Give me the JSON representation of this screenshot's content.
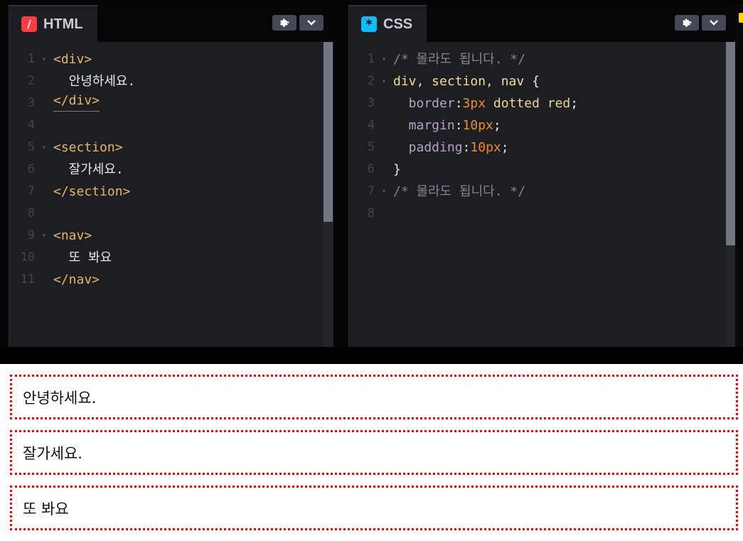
{
  "html_panel": {
    "title": "HTML",
    "icon_glyph": "/",
    "lines": [
      {
        "n": "1",
        "fold": true,
        "parts": [
          {
            "t": "<div>",
            "c": "tag"
          }
        ]
      },
      {
        "n": "2",
        "fold": false,
        "parts": [
          {
            "t": "  안녕하세요.",
            "c": "txt"
          }
        ]
      },
      {
        "n": "3",
        "fold": false,
        "parts": [
          {
            "t": "</div>",
            "c": "tag tag-ul"
          }
        ]
      },
      {
        "n": "4",
        "fold": false,
        "parts": []
      },
      {
        "n": "5",
        "fold": true,
        "parts": [
          {
            "t": "<section>",
            "c": "tag"
          }
        ]
      },
      {
        "n": "6",
        "fold": false,
        "parts": [
          {
            "t": "  잘가세요.",
            "c": "txt"
          }
        ]
      },
      {
        "n": "7",
        "fold": false,
        "parts": [
          {
            "t": "</section>",
            "c": "tag"
          }
        ]
      },
      {
        "n": "8",
        "fold": false,
        "parts": []
      },
      {
        "n": "9",
        "fold": true,
        "parts": [
          {
            "t": "<nav>",
            "c": "tag"
          }
        ]
      },
      {
        "n": "10",
        "fold": false,
        "parts": [
          {
            "t": "  또 봐요",
            "c": "txt"
          }
        ]
      },
      {
        "n": "11",
        "fold": false,
        "parts": [
          {
            "t": "</nav>",
            "c": "tag"
          }
        ]
      }
    ]
  },
  "css_panel": {
    "title": "CSS",
    "icon_glyph": "*",
    "lines": [
      {
        "n": "1",
        "fold": true,
        "parts": [
          {
            "t": "/* 몰라도 됩니다. */",
            "c": "cmt"
          }
        ]
      },
      {
        "n": "2",
        "fold": true,
        "parts": [
          {
            "t": "div, section, nav ",
            "c": "sel"
          },
          {
            "t": "{",
            "c": "punc"
          }
        ]
      },
      {
        "n": "3",
        "fold": false,
        "parts": [
          {
            "t": "  border",
            "c": "prop"
          },
          {
            "t": ":",
            "c": "punc"
          },
          {
            "t": "3px",
            "c": "num"
          },
          {
            "t": " dotted red",
            "c": "val"
          },
          {
            "t": ";",
            "c": "punc"
          }
        ]
      },
      {
        "n": "4",
        "fold": false,
        "parts": [
          {
            "t": "  margin",
            "c": "prop"
          },
          {
            "t": ":",
            "c": "punc"
          },
          {
            "t": "10px",
            "c": "num"
          },
          {
            "t": ";",
            "c": "punc"
          }
        ]
      },
      {
        "n": "5",
        "fold": false,
        "parts": [
          {
            "t": "  padding",
            "c": "prop"
          },
          {
            "t": ":",
            "c": "punc"
          },
          {
            "t": "10px",
            "c": "num"
          },
          {
            "t": ";",
            "c": "punc"
          }
        ]
      },
      {
        "n": "6",
        "fold": false,
        "parts": [
          {
            "t": "}",
            "c": "punc"
          }
        ]
      },
      {
        "n": "7",
        "fold": true,
        "parts": [
          {
            "t": "/* 몰라도 됩니다. */",
            "c": "cmt"
          }
        ]
      },
      {
        "n": "8",
        "fold": false,
        "parts": []
      }
    ]
  },
  "icons": {
    "settings": "gear-icon",
    "collapse": "chevron-down-icon"
  },
  "preview": {
    "boxes": [
      "안녕하세요.",
      "잘가세요.",
      "또 봐요"
    ]
  },
  "colors": {
    "html_badge": "#ff3c41",
    "css_badge": "#0ebeff",
    "preview_border": "#ff0000"
  }
}
